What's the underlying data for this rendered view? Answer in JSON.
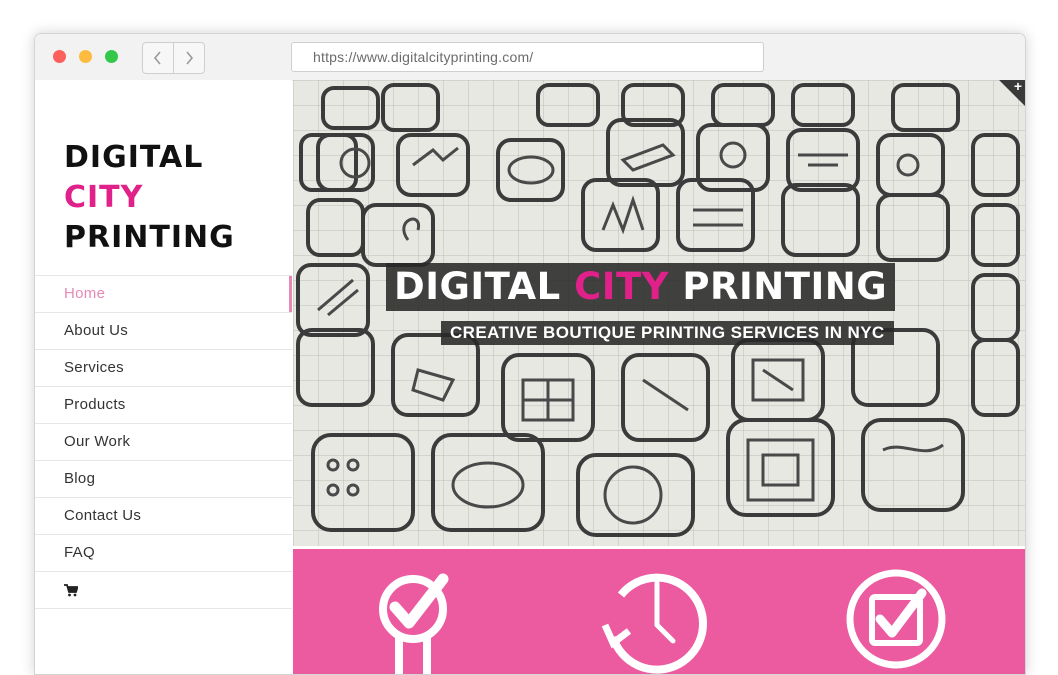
{
  "browser": {
    "url": "https://www.digitalcityprinting.com/"
  },
  "logo": {
    "line1": "DIGITAL",
    "line2": "CITY",
    "line3": "PRINTING"
  },
  "menu": {
    "items": [
      {
        "label": "Home"
      },
      {
        "label": "About Us"
      },
      {
        "label": "Services"
      },
      {
        "label": "Products"
      },
      {
        "label": "Our Work"
      },
      {
        "label": "Blog"
      },
      {
        "label": "Contact Us"
      },
      {
        "label": "FAQ"
      }
    ],
    "cart_icon": "shopping-cart-icon"
  },
  "hero": {
    "title_part1": "DIGITAL ",
    "title_accent": "CITY",
    "title_part2": " PRINTING",
    "subtitle": "CREATIVE BOUTIQUE PRINTING SERVICES IN NYC",
    "corner_icon": "plus-icon"
  },
  "features": {
    "icons": [
      "checkmark-badge-icon",
      "clock-icon",
      "checkbox-icon"
    ]
  },
  "colors": {
    "brand_pink": "#e0218a",
    "menu_active": "#e889b5",
    "feature_band": "#ec5aa0"
  }
}
